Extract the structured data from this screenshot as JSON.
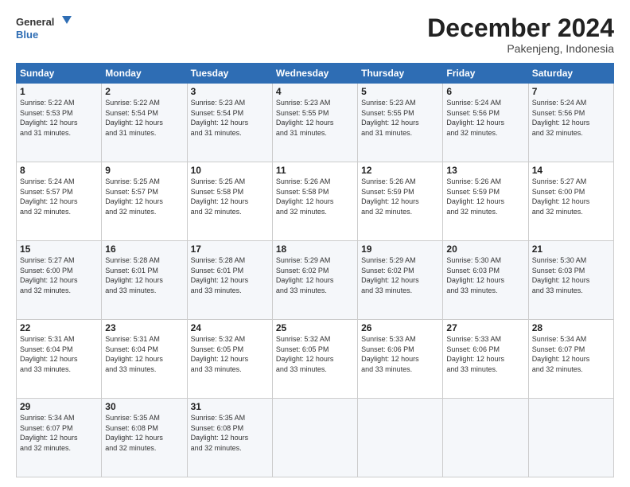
{
  "header": {
    "logo_line1": "General",
    "logo_line2": "Blue",
    "month": "December 2024",
    "location": "Pakenjeng, Indonesia"
  },
  "days_of_week": [
    "Sunday",
    "Monday",
    "Tuesday",
    "Wednesday",
    "Thursday",
    "Friday",
    "Saturday"
  ],
  "weeks": [
    [
      {
        "day": "1",
        "info": "Sunrise: 5:22 AM\nSunset: 5:53 PM\nDaylight: 12 hours\nand 31 minutes."
      },
      {
        "day": "2",
        "info": "Sunrise: 5:22 AM\nSunset: 5:54 PM\nDaylight: 12 hours\nand 31 minutes."
      },
      {
        "day": "3",
        "info": "Sunrise: 5:23 AM\nSunset: 5:54 PM\nDaylight: 12 hours\nand 31 minutes."
      },
      {
        "day": "4",
        "info": "Sunrise: 5:23 AM\nSunset: 5:55 PM\nDaylight: 12 hours\nand 31 minutes."
      },
      {
        "day": "5",
        "info": "Sunrise: 5:23 AM\nSunset: 5:55 PM\nDaylight: 12 hours\nand 31 minutes."
      },
      {
        "day": "6",
        "info": "Sunrise: 5:24 AM\nSunset: 5:56 PM\nDaylight: 12 hours\nand 32 minutes."
      },
      {
        "day": "7",
        "info": "Sunrise: 5:24 AM\nSunset: 5:56 PM\nDaylight: 12 hours\nand 32 minutes."
      }
    ],
    [
      {
        "day": "8",
        "info": "Sunrise: 5:24 AM\nSunset: 5:57 PM\nDaylight: 12 hours\nand 32 minutes."
      },
      {
        "day": "9",
        "info": "Sunrise: 5:25 AM\nSunset: 5:57 PM\nDaylight: 12 hours\nand 32 minutes."
      },
      {
        "day": "10",
        "info": "Sunrise: 5:25 AM\nSunset: 5:58 PM\nDaylight: 12 hours\nand 32 minutes."
      },
      {
        "day": "11",
        "info": "Sunrise: 5:26 AM\nSunset: 5:58 PM\nDaylight: 12 hours\nand 32 minutes."
      },
      {
        "day": "12",
        "info": "Sunrise: 5:26 AM\nSunset: 5:59 PM\nDaylight: 12 hours\nand 32 minutes."
      },
      {
        "day": "13",
        "info": "Sunrise: 5:26 AM\nSunset: 5:59 PM\nDaylight: 12 hours\nand 32 minutes."
      },
      {
        "day": "14",
        "info": "Sunrise: 5:27 AM\nSunset: 6:00 PM\nDaylight: 12 hours\nand 32 minutes."
      }
    ],
    [
      {
        "day": "15",
        "info": "Sunrise: 5:27 AM\nSunset: 6:00 PM\nDaylight: 12 hours\nand 32 minutes."
      },
      {
        "day": "16",
        "info": "Sunrise: 5:28 AM\nSunset: 6:01 PM\nDaylight: 12 hours\nand 33 minutes."
      },
      {
        "day": "17",
        "info": "Sunrise: 5:28 AM\nSunset: 6:01 PM\nDaylight: 12 hours\nand 33 minutes."
      },
      {
        "day": "18",
        "info": "Sunrise: 5:29 AM\nSunset: 6:02 PM\nDaylight: 12 hours\nand 33 minutes."
      },
      {
        "day": "19",
        "info": "Sunrise: 5:29 AM\nSunset: 6:02 PM\nDaylight: 12 hours\nand 33 minutes."
      },
      {
        "day": "20",
        "info": "Sunrise: 5:30 AM\nSunset: 6:03 PM\nDaylight: 12 hours\nand 33 minutes."
      },
      {
        "day": "21",
        "info": "Sunrise: 5:30 AM\nSunset: 6:03 PM\nDaylight: 12 hours\nand 33 minutes."
      }
    ],
    [
      {
        "day": "22",
        "info": "Sunrise: 5:31 AM\nSunset: 6:04 PM\nDaylight: 12 hours\nand 33 minutes."
      },
      {
        "day": "23",
        "info": "Sunrise: 5:31 AM\nSunset: 6:04 PM\nDaylight: 12 hours\nand 33 minutes."
      },
      {
        "day": "24",
        "info": "Sunrise: 5:32 AM\nSunset: 6:05 PM\nDaylight: 12 hours\nand 33 minutes."
      },
      {
        "day": "25",
        "info": "Sunrise: 5:32 AM\nSunset: 6:05 PM\nDaylight: 12 hours\nand 33 minutes."
      },
      {
        "day": "26",
        "info": "Sunrise: 5:33 AM\nSunset: 6:06 PM\nDaylight: 12 hours\nand 33 minutes."
      },
      {
        "day": "27",
        "info": "Sunrise: 5:33 AM\nSunset: 6:06 PM\nDaylight: 12 hours\nand 33 minutes."
      },
      {
        "day": "28",
        "info": "Sunrise: 5:34 AM\nSunset: 6:07 PM\nDaylight: 12 hours\nand 32 minutes."
      }
    ],
    [
      {
        "day": "29",
        "info": "Sunrise: 5:34 AM\nSunset: 6:07 PM\nDaylight: 12 hours\nand 32 minutes."
      },
      {
        "day": "30",
        "info": "Sunrise: 5:35 AM\nSunset: 6:08 PM\nDaylight: 12 hours\nand 32 minutes."
      },
      {
        "day": "31",
        "info": "Sunrise: 5:35 AM\nSunset: 6:08 PM\nDaylight: 12 hours\nand 32 minutes."
      },
      {
        "day": "",
        "info": ""
      },
      {
        "day": "",
        "info": ""
      },
      {
        "day": "",
        "info": ""
      },
      {
        "day": "",
        "info": ""
      }
    ]
  ]
}
